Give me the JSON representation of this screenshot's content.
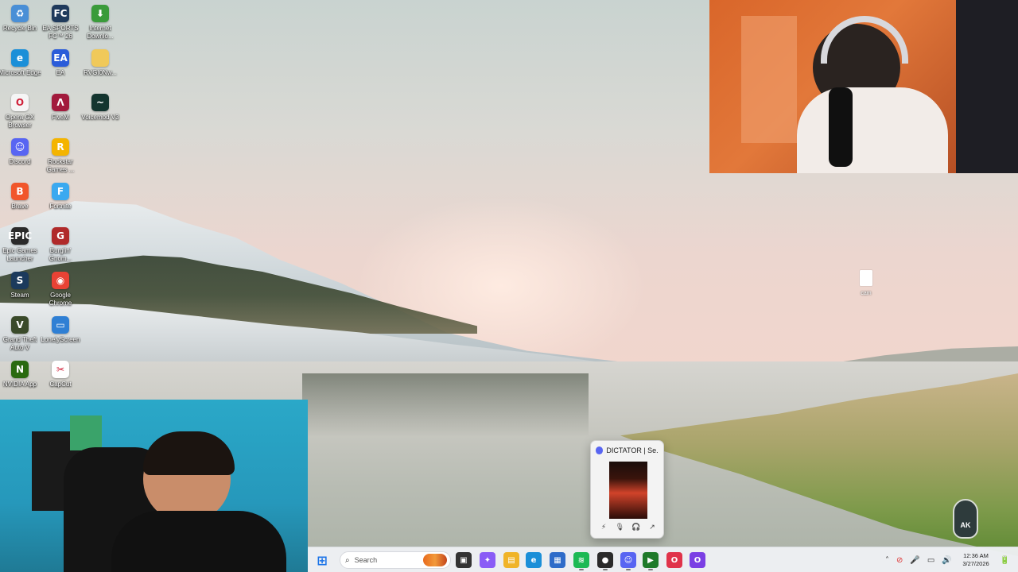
{
  "desktop": {
    "icons": [
      {
        "label": "Recycle Bin",
        "icon": "recycle-bin-icon",
        "color": "#4a8fd6",
        "glyph": "♻"
      },
      {
        "label": "EA SPORTS FC™ 26",
        "icon": "ea-fc-icon",
        "color": "#1f3a5c",
        "glyph": "FC"
      },
      {
        "label": "Internet Downlo...",
        "icon": "internet-download-icon",
        "color": "#3a9b3a",
        "glyph": "⬇"
      },
      {
        "label": "Microsoft Edge",
        "icon": "edge-icon",
        "color": "#1b8fd8",
        "glyph": "e"
      },
      {
        "label": "EA",
        "icon": "ea-app-icon",
        "color": "#2b5cd9",
        "glyph": "EA"
      },
      {
        "label": "RVGI0Nw...",
        "icon": "folder-icon",
        "color": "#f0c95a",
        "glyph": ""
      },
      {
        "label": "Opera GX Browser",
        "icon": "opera-gx-icon",
        "color": "#f5f5f5",
        "glyph": "O"
      },
      {
        "label": "FiveM",
        "icon": "fivem-icon",
        "color": "#a21a3c",
        "glyph": "Λ"
      },
      {
        "label": "Voicemod V3",
        "icon": "voicemod-icon",
        "color": "#14352f",
        "glyph": "~"
      },
      {
        "label": "Discord",
        "icon": "discord-icon",
        "color": "#5865f2",
        "glyph": "☺"
      },
      {
        "label": "Rockstar Games ...",
        "icon": "rockstar-icon",
        "color": "#f4b400",
        "glyph": "R"
      },
      {
        "label": "Brave",
        "icon": "brave-icon",
        "color": "#f1562b",
        "glyph": "B"
      },
      {
        "label": "Fortnite",
        "icon": "fortnite-icon",
        "color": "#3aa9f0",
        "glyph": "F"
      },
      {
        "label": "Epic Games Launcher",
        "icon": "epic-games-icon",
        "color": "#2a2a2a",
        "glyph": "EPIC"
      },
      {
        "label": "Burglin' Gnom...",
        "icon": "burglin-gnomes-icon",
        "color": "#b02a2a",
        "glyph": "G"
      },
      {
        "label": "Steam",
        "icon": "steam-icon",
        "color": "#1b3a5c",
        "glyph": "S"
      },
      {
        "label": "Google Chrome",
        "icon": "chrome-icon",
        "color": "#e94235",
        "glyph": "◉"
      },
      {
        "label": "Grand Theft Auto V",
        "icon": "gta-v-icon",
        "color": "#3a4a2a",
        "glyph": "V"
      },
      {
        "label": "LonelyScreen",
        "icon": "lonelyscreen-icon",
        "color": "#2f7fd4",
        "glyph": "▭"
      },
      {
        "label": "NVIDIA App",
        "icon": "nvidia-icon",
        "color": "#2a6a10",
        "glyph": "N"
      },
      {
        "label": "CapCut",
        "icon": "capcut-icon",
        "color": "#ffffff",
        "glyph": "✂"
      }
    ],
    "file": {
      "label": "cam"
    }
  },
  "preview": {
    "title": "DICTATOR | Se...",
    "controls": [
      "⚡",
      "🎙",
      "🎧",
      "↗"
    ]
  },
  "taskbar": {
    "search_placeholder": "Search",
    "apps": [
      {
        "name": "windows-start-icon",
        "color": "#1a73e8",
        "glyph": "⊞"
      },
      {
        "name": "task-view-icon",
        "color": "#333333",
        "glyph": "▣"
      },
      {
        "name": "copilot-icon",
        "color": "#8a5cf6",
        "glyph": "✦"
      },
      {
        "name": "file-explorer-icon",
        "color": "#f0b429",
        "glyph": "▤"
      },
      {
        "name": "edge-taskbar-icon",
        "color": "#1b8fd8",
        "glyph": "e"
      },
      {
        "name": "store-icon",
        "color": "#2f6cc9",
        "glyph": "▦"
      },
      {
        "name": "spotify-icon",
        "color": "#1db954",
        "glyph": "≋"
      },
      {
        "name": "obs-icon",
        "color": "#2b2b2b",
        "glyph": "●"
      },
      {
        "name": "discord-taskbar-icon",
        "color": "#5865f2",
        "glyph": "☺"
      },
      {
        "name": "terminal-icon",
        "color": "#1f7a2a",
        "glyph": "▶"
      },
      {
        "name": "opera-taskbar-icon",
        "color": "#e0334a",
        "glyph": "O"
      },
      {
        "name": "opera-gx-taskbar-icon",
        "color": "#7b3fe4",
        "glyph": "O"
      }
    ],
    "tray": [
      "˄",
      "⊘",
      "🎤",
      "▭",
      "🔊",
      "🔋"
    ],
    "time": "12:36 AM",
    "date": "3/27/2026"
  },
  "watermark": {
    "text": "AK"
  }
}
